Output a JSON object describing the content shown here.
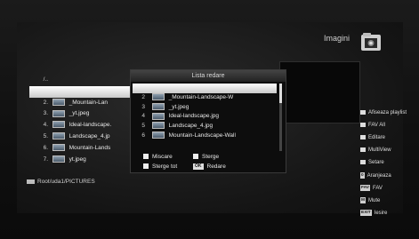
{
  "header": {
    "title": "Imagini"
  },
  "file_list": {
    "parent": "/..",
    "items": [
      {
        "index": "",
        "name": "",
        "selected": true
      },
      {
        "index": "2.",
        "name": "_Mountain-Lan",
        "selected": false
      },
      {
        "index": "3.",
        "name": "_yt.jpeg",
        "selected": false
      },
      {
        "index": "4.",
        "name": "Ideal-landscape.",
        "selected": false
      },
      {
        "index": "5.",
        "name": "Landscape_4.jp",
        "selected": false
      },
      {
        "index": "6.",
        "name": "Mountain-Lands",
        "selected": false
      },
      {
        "index": "7.",
        "name": "yt.jpeg",
        "selected": false
      }
    ]
  },
  "path": "Root/uda1/PICTURES",
  "playlist": {
    "title": "Lista redare",
    "items": [
      {
        "index": "",
        "name": "",
        "selected": true
      },
      {
        "index": "2",
        "name": "_Mountain-Landscape-W",
        "selected": false
      },
      {
        "index": "3",
        "name": "_yt.jpeg",
        "selected": false
      },
      {
        "index": "4",
        "name": "Ideal-landscape.jpg",
        "selected": false
      },
      {
        "index": "5",
        "name": "Landscape_4.jpg",
        "selected": false
      },
      {
        "index": "6",
        "name": "Mountain-Landscape-Wall",
        "selected": false
      }
    ],
    "actions": {
      "move": "Miscare",
      "delete": "Sterge",
      "delete_all": "Sterge tot",
      "ok_key": "OK",
      "play": "Redare"
    }
  },
  "menu": {
    "show_playlist": "Afiseaza playlist",
    "fav_all": "FAV All",
    "edit": "Editare",
    "multiview": "MultiView",
    "settings": "Setare",
    "arrange_key": "0",
    "arrange": "Aranjeaza",
    "fav_key": "FAV",
    "fav": "FAV",
    "mute_key": "M",
    "mute": "Mute",
    "exit_key": "EXIT",
    "exit": "Iesire"
  },
  "colors": {
    "background": "#151515",
    "highlight": "#ffffff",
    "text": "#e8e8e8"
  }
}
